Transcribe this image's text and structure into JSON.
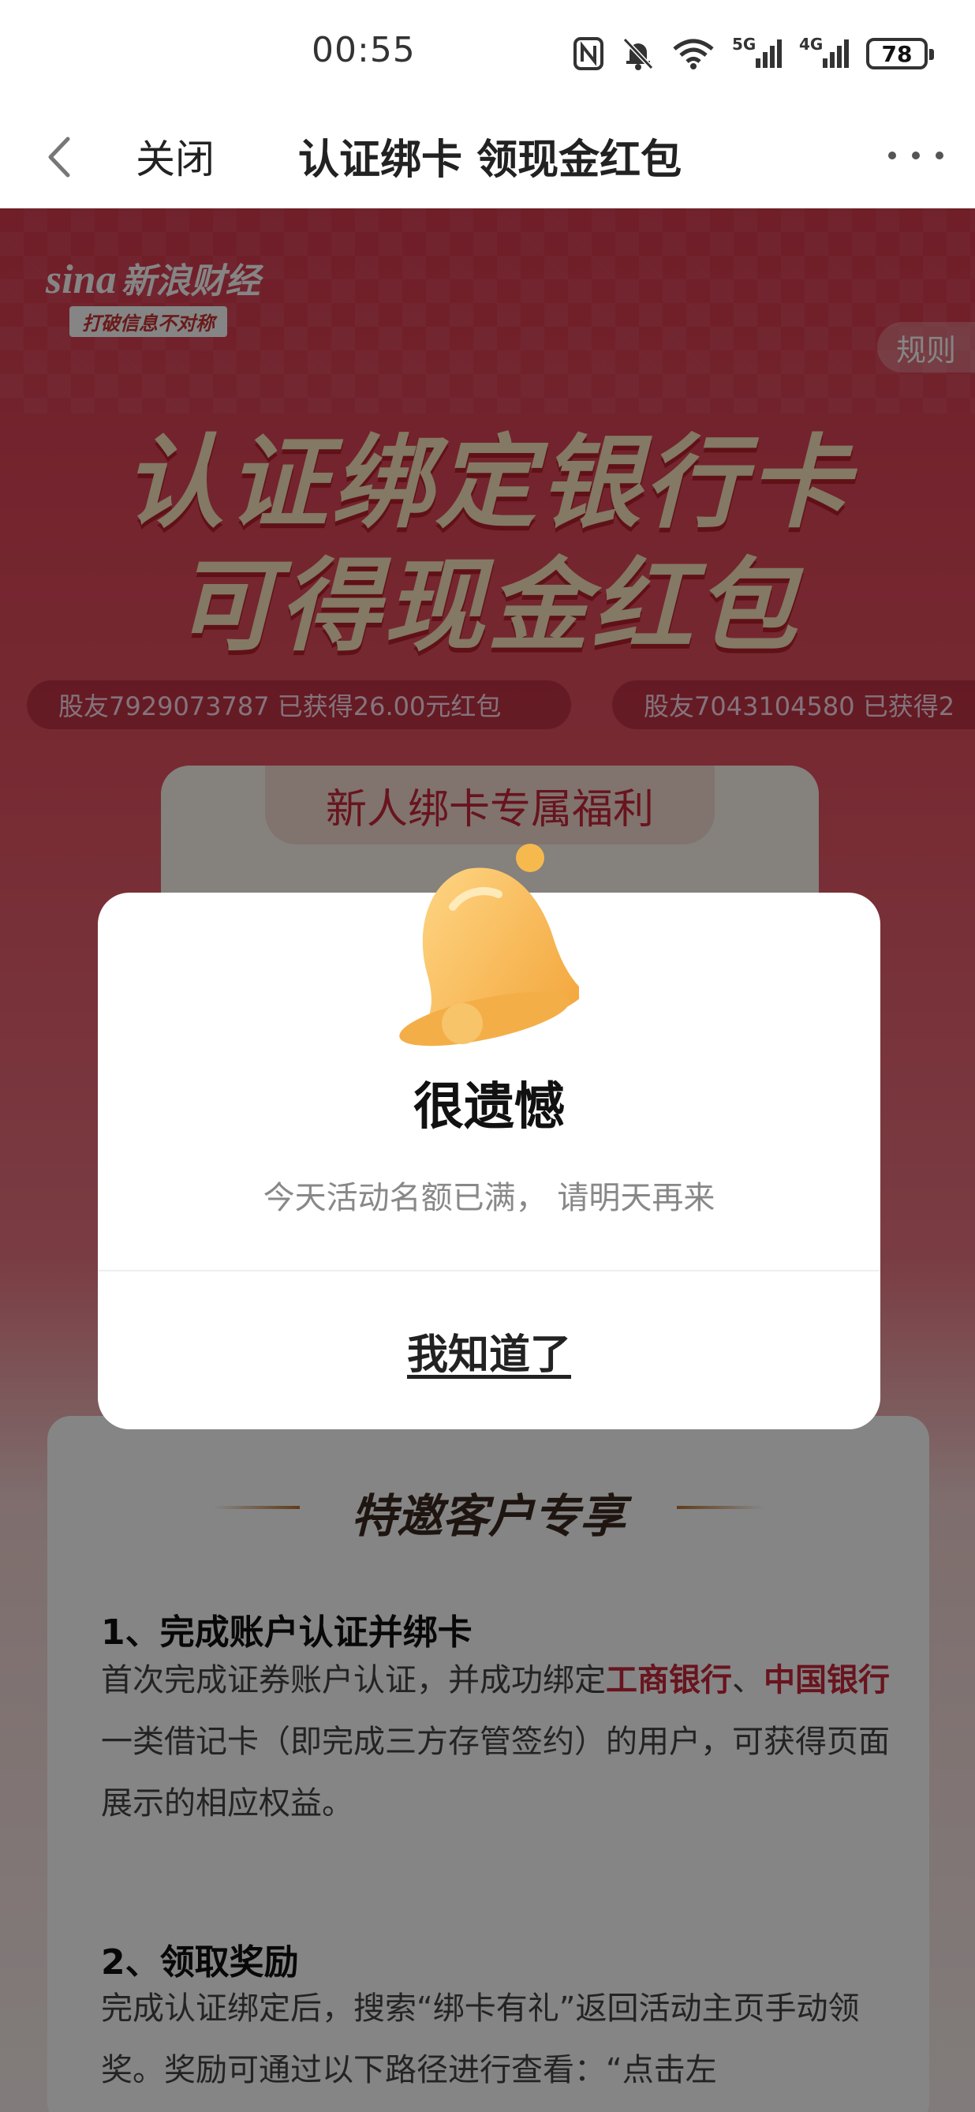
{
  "status_bar": {
    "time": "00:55",
    "battery": "78",
    "signal_5g_label": "5G",
    "signal_4g_label": "4G"
  },
  "nav": {
    "close_label": "关闭",
    "title": "认证绑卡 领现金红包"
  },
  "banner": {
    "logo_brand": "sina",
    "logo_name": "新浪财经",
    "logo_slogan": "打破信息不对称",
    "rules_label": "规则",
    "hero_line1": "认证绑定银行卡",
    "hero_line2": "可得现金红包",
    "ticker_items": [
      "股友7929073787 已获得26.00元红包",
      "股友7043104580 已获得2"
    ],
    "welfare_title": "新人绑卡专属福利"
  },
  "invite": {
    "title": "特邀客户专享",
    "step1_heading": "1、完成账户认证并绑卡",
    "step1_text_a": "首次完成证券账户认证，并成功绑定",
    "step1_bank1": "工商银行",
    "step1_sep": "、",
    "step1_bank2": "中国银行",
    "step1_text_b": "一类借记卡（即完成三方存管签约）的用户，可获得页面展示的相应权益。",
    "step2_heading": "2、领取奖励",
    "step2_text": "完成认证绑定后，搜索“绑卡有礼”返回活动主页手动领奖。奖励可通过以下路径进行查看：“点击左"
  },
  "dialog": {
    "title": "很遗憾",
    "message": "今天活动名额已满， 请明天再来",
    "confirm_label": "我知道了"
  },
  "colors": {
    "accent_red": "#c8283a",
    "banner_red": "#d63a4e",
    "hero_text": "#fbe8c0",
    "bell_gold": "#f6b94e"
  }
}
